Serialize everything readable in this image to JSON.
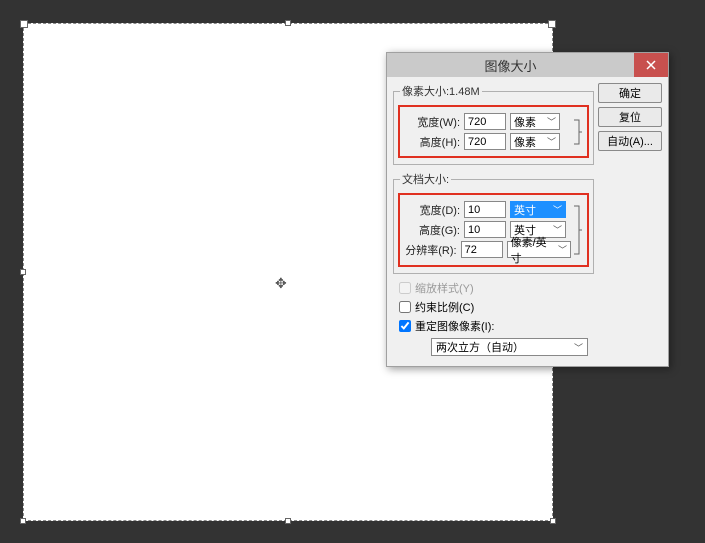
{
  "dialog": {
    "title": "图像大小",
    "buttons": {
      "ok": "确定",
      "reset": "复位",
      "auto": "自动(A)..."
    },
    "pixel_section": {
      "legend": "像素大小:1.48M",
      "width_label": "宽度(W):",
      "width_value": "720",
      "width_unit": "像素",
      "height_label": "高度(H):",
      "height_value": "720",
      "height_unit": "像素"
    },
    "doc_section": {
      "legend": "文档大小:",
      "width_label": "宽度(D):",
      "width_value": "10",
      "width_unit": "英寸",
      "height_label": "高度(G):",
      "height_value": "10",
      "height_unit": "英寸",
      "res_label": "分辨率(R):",
      "res_value": "72",
      "res_unit": "像素/英寸"
    },
    "scale_styles": "缩放样式(Y)",
    "constrain": "约束比例(C)",
    "resample": "重定图像像素(I):",
    "resample_method": "两次立方（自动）"
  }
}
